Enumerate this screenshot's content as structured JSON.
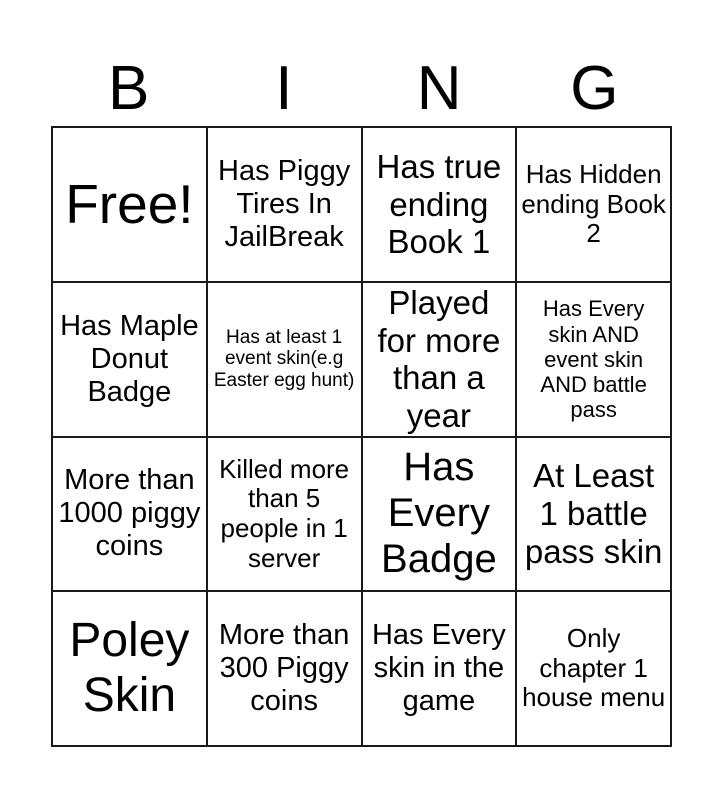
{
  "card": {
    "title": "BINGO",
    "columns": 4,
    "rows": 4,
    "grid_color": "#1a1a1a",
    "cell_background": "#ffffff",
    "text_color": "#000000",
    "page_background": "#ffffff",
    "header_letters": [
      "B",
      "I",
      "N",
      "G"
    ],
    "cells": [
      {
        "text": "Free!",
        "size": "fs-free"
      },
      {
        "text": "Has Piggy Tires In JailBreak",
        "size": "fs-md"
      },
      {
        "text": "Has true ending Book 1",
        "size": "fs-lg"
      },
      {
        "text": "Has Hidden ending Book 2",
        "size": "fs-sm"
      },
      {
        "text": "Has Maple Donut Badge",
        "size": "fs-md"
      },
      {
        "text": "Has at least 1 event skin(e.g Easter egg hunt)",
        "size": "fs-xxs"
      },
      {
        "text": "Played for more than a year",
        "size": "fs-lg"
      },
      {
        "text": "Has Every skin AND event skin AND battle pass",
        "size": "fs-xs"
      },
      {
        "text": "More than 1000 piggy coins",
        "size": "fs-md"
      },
      {
        "text": "Killed more than 5 people in 1 server",
        "size": "fs-sm"
      },
      {
        "text": "Has Every Badge",
        "size": "fs-xl"
      },
      {
        "text": "At Least 1 battle pass skin",
        "size": "fs-lg"
      },
      {
        "text": "Poley Skin",
        "size": "fs-xxl"
      },
      {
        "text": "More than 300 Piggy coins",
        "size": "fs-md"
      },
      {
        "text": "Has Every skin in the game",
        "size": "fs-md"
      },
      {
        "text": "Only chapter 1 house menu",
        "size": "fs-sm"
      }
    ]
  }
}
